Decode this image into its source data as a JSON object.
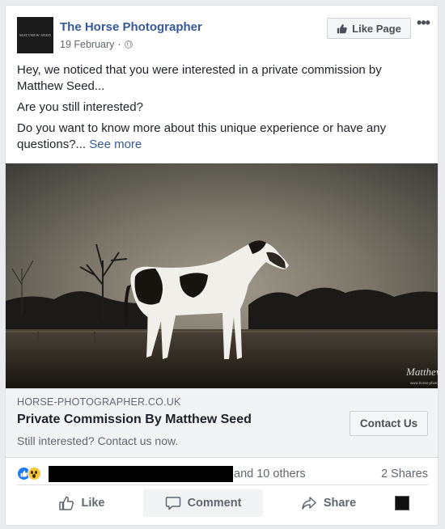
{
  "post": {
    "page_name": "The Horse Photographer",
    "page_logo_text": "MATTHEW SEED",
    "date": "19 February",
    "separator": "·",
    "privacy_icon": "globe-icon",
    "like_page_label": "Like Page",
    "more_label": "•••",
    "text": {
      "line1": "Hey, we noticed that you were interested in a private commission by Matthew Seed...",
      "line2": "Are you still interested?",
      "line3": "Do you want to know more about this unique experience or have any questions?...",
      "see_more": "See more"
    }
  },
  "image": {
    "signature_text": "Matthew Seed",
    "watermark_text": "www.horse-photographer.co.uk"
  },
  "link_preview": {
    "domain": "HORSE-PHOTOGRAPHER.CO.UK",
    "title": "Private Commission By Matthew Seed",
    "description": "Still interested? Contact us now.",
    "cta_label": "Contact Us"
  },
  "reactions": {
    "icons": [
      "like-reaction-icon",
      "wow-reaction-icon"
    ],
    "others_text": "and 10 others",
    "shares_text": "2 Shares"
  },
  "actions": {
    "like_label": "Like",
    "comment_label": "Comment",
    "share_label": "Share"
  },
  "colors": {
    "brand_blue": "#365899",
    "like_blue": "#2078f4",
    "text_dark": "#1d2129",
    "text_muted": "#606770",
    "background": "#e9ebee"
  }
}
